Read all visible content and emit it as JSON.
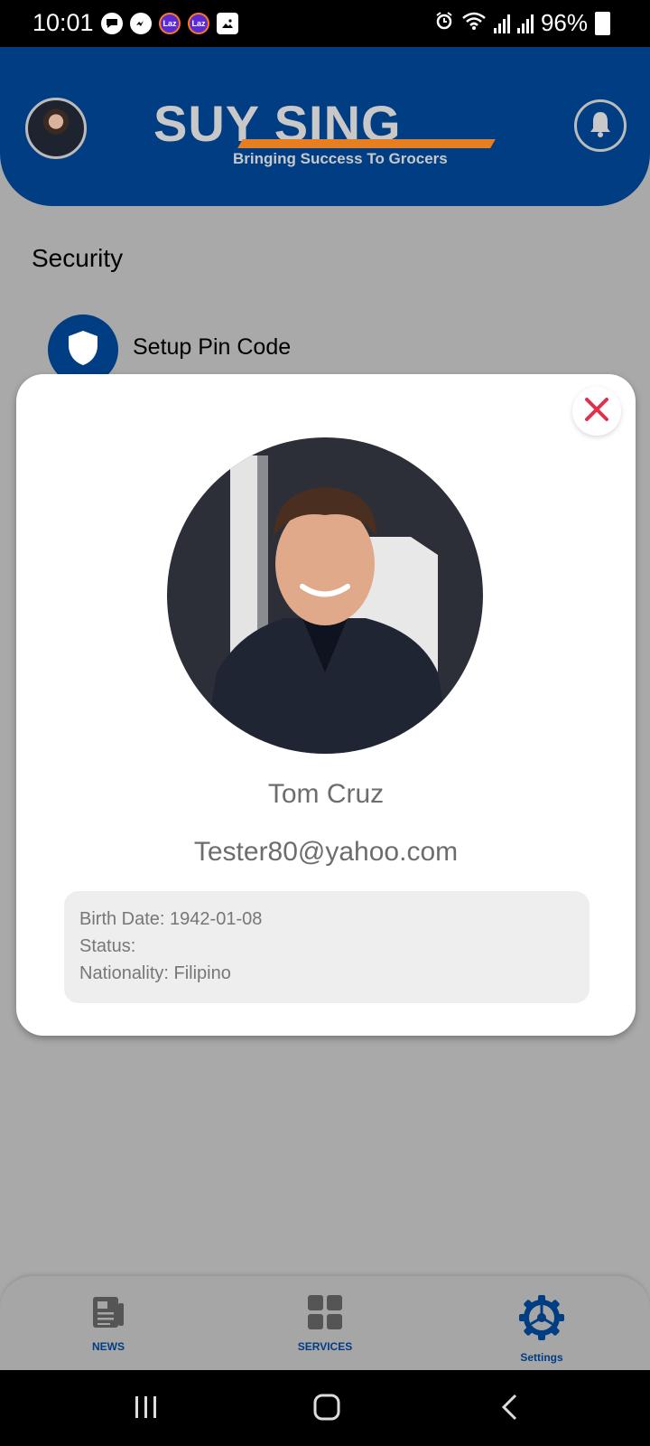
{
  "status_bar": {
    "time": "10:01",
    "battery": "96%",
    "notification_icons": [
      "chat-bubble-icon",
      "messenger-icon",
      "lazada-icon",
      "lazada-icon",
      "gallery-icon"
    ],
    "laz_text": "Laz",
    "right_icons": [
      "alarm-icon",
      "wifi-icon",
      "signal-icon",
      "signal-icon",
      "battery-charging-icon"
    ]
  },
  "header": {
    "brand_name": "SUY SING",
    "tagline": "Bringing Success To Grocers",
    "background_color": "#003d82",
    "accent_color": "#e67e22"
  },
  "security": {
    "section_title": "Security",
    "setup_pin_label": "Setup Pin Code"
  },
  "profile_modal": {
    "name": "Tom Cruz",
    "email": "Tester80@yahoo.com",
    "birth_date": "Birth Date: 1942-01-08",
    "status": "Status:",
    "nationality": "Nationality: Filipino",
    "close_color": "#e0314b"
  },
  "bottom_nav": {
    "news_label": "NEWS",
    "services_label": "SERVICES",
    "settings_label": "Settings",
    "active_color": "#003d82",
    "inactive_color": "#555555"
  },
  "system_nav": {
    "buttons": [
      "recents-icon",
      "home-icon",
      "back-icon"
    ]
  }
}
